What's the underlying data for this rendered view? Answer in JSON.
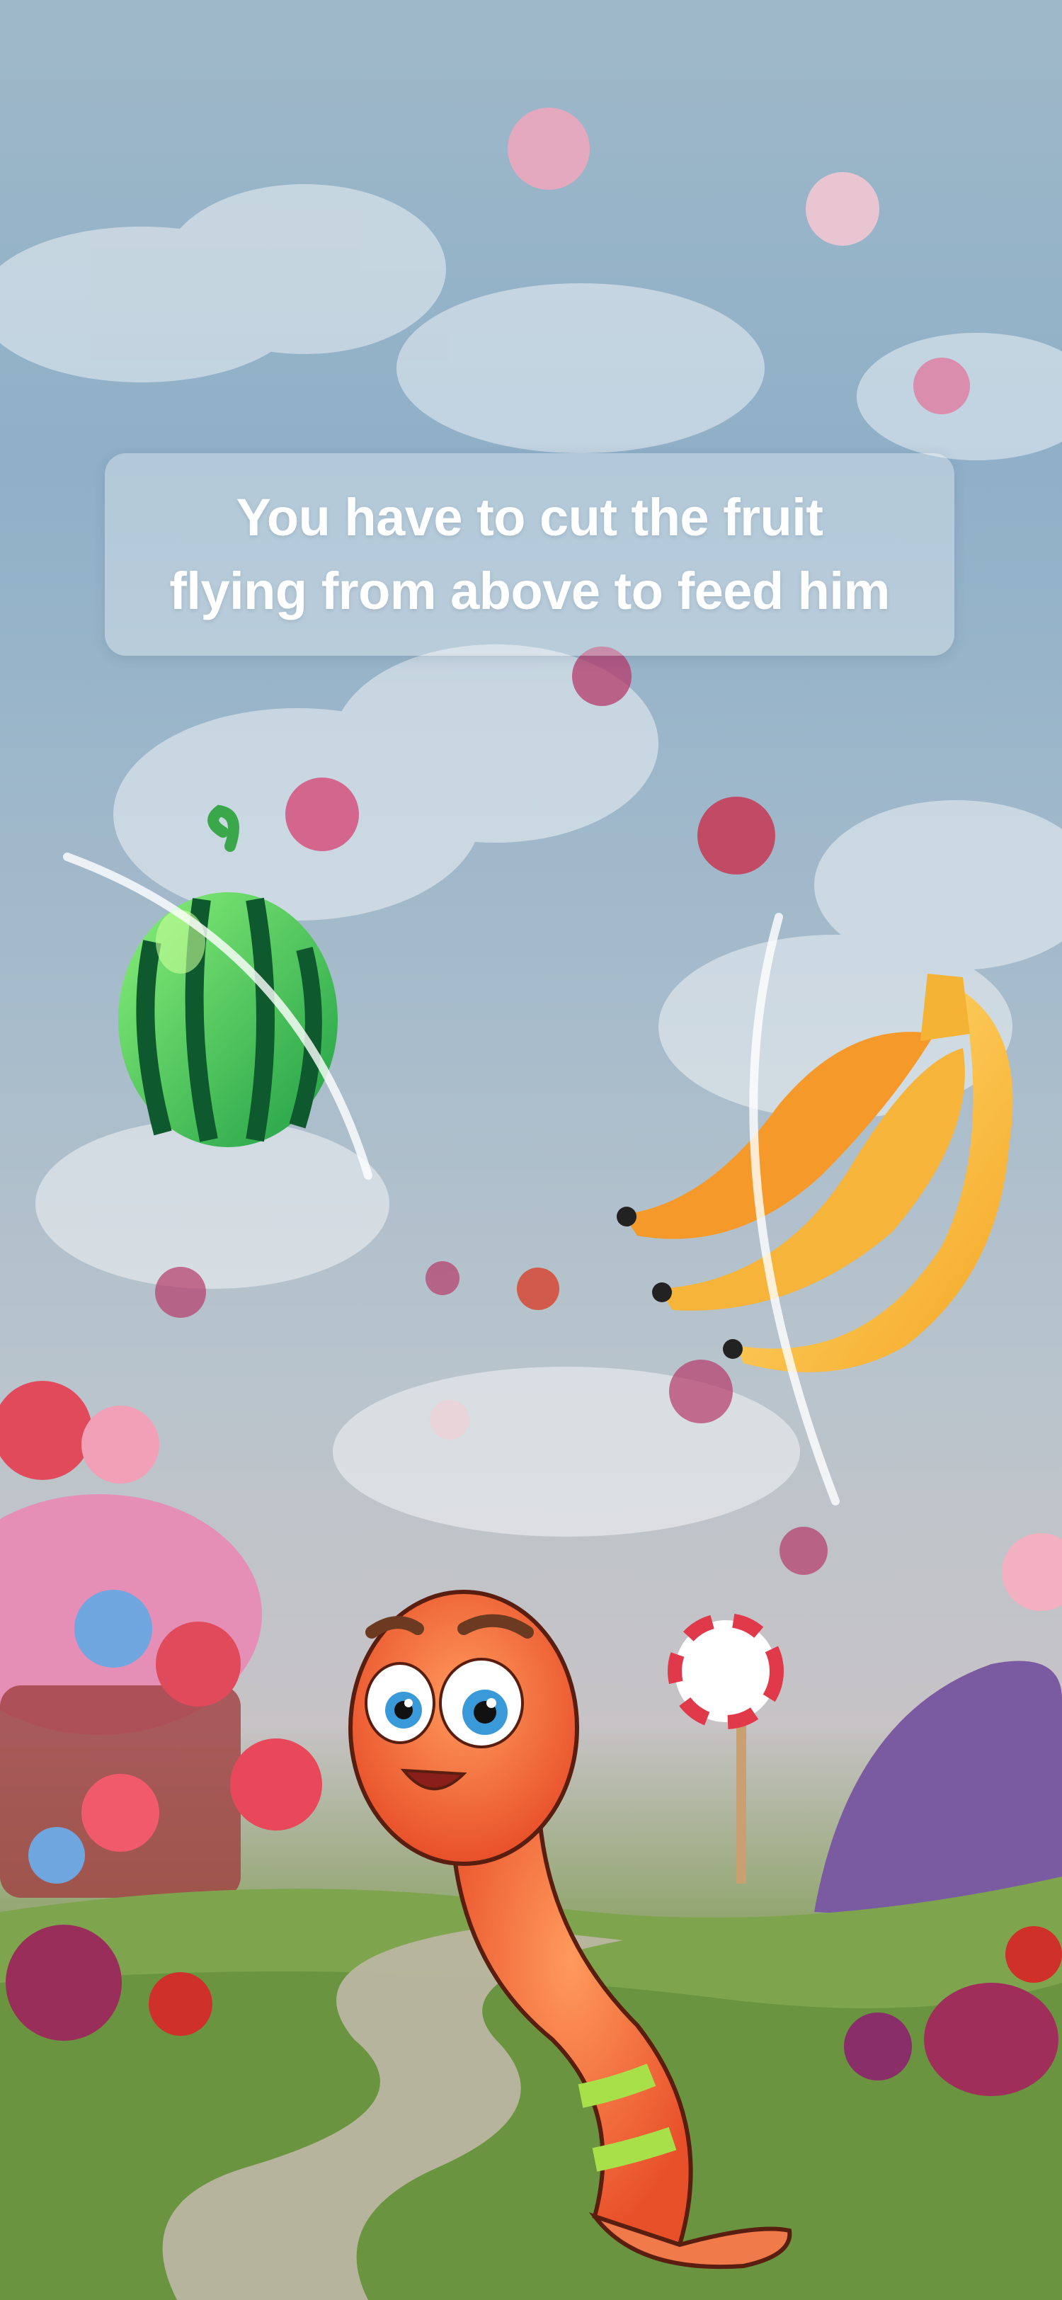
{
  "hint": {
    "message": "You have to cut the fruit\nflying from above to feed him"
  },
  "scene": {
    "fruits": [
      "watermelon",
      "banana-bunch"
    ],
    "character": "worm",
    "effects": [
      "swipe-slash",
      "swipe-slash"
    ]
  },
  "colors": {
    "sky": "#9fb8c8",
    "grass": "#6f9a45",
    "worm": "#f26a3a",
    "watermelon": "#3fbf55",
    "banana": "#f7c340"
  }
}
